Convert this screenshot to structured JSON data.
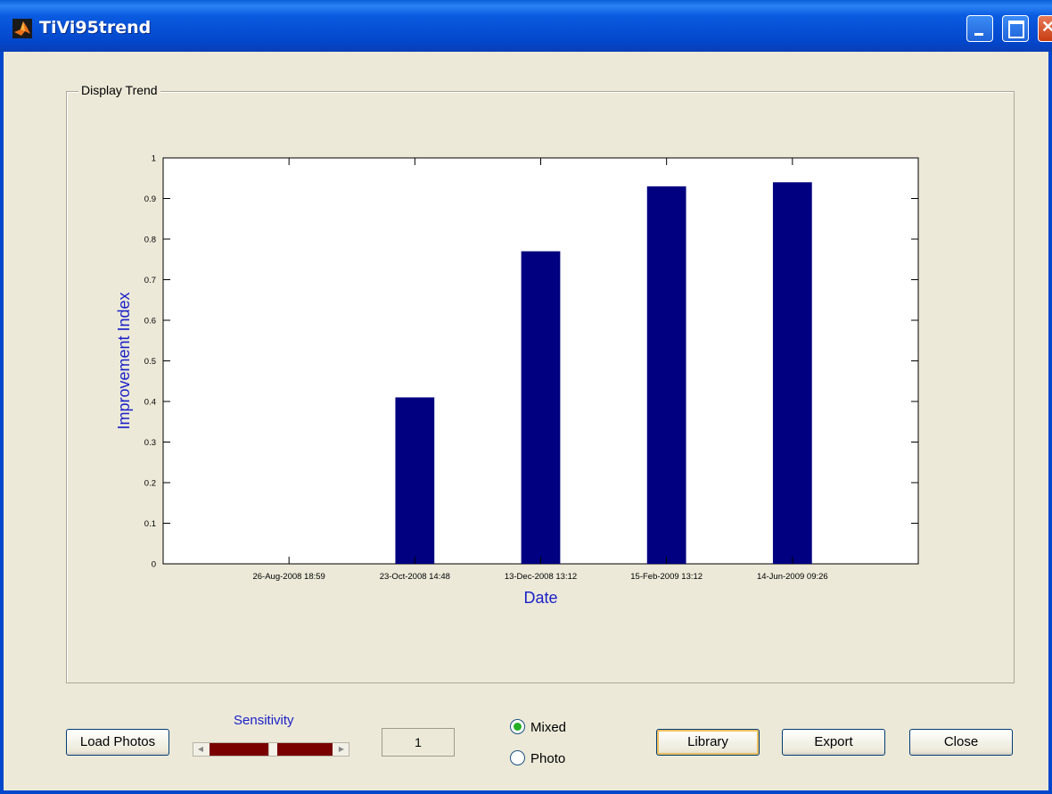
{
  "window": {
    "title": "TiVi95trend"
  },
  "panel": {
    "title": "Display Trend"
  },
  "chart_data": {
    "type": "bar",
    "categories": [
      "26-Aug-2008 18:59",
      "23-Oct-2008 14:48",
      "13-Dec-2008 13:12",
      "15-Feb-2009 13:12",
      "14-Jun-2009 09:26"
    ],
    "values": [
      0,
      0.41,
      0.77,
      0.93,
      0.94
    ],
    "title": "",
    "xlabel": "Date",
    "ylabel": "Improvement Index",
    "ylim": [
      0,
      1
    ],
    "yticks": [
      "0",
      "0.1",
      "0.2",
      "0.3",
      "0.4",
      "0.5",
      "0.6",
      "0.7",
      "0.8",
      "0.9",
      "1"
    ],
    "bar_color": "#000080",
    "label_color": "#1b20c8"
  },
  "controls": {
    "load_photos_label": "Load Photos",
    "sensitivity_label": "Sensitivity",
    "sensitivity_value": "1",
    "mode_options": [
      {
        "label": "Mixed",
        "checked": true
      },
      {
        "label": "Photo",
        "checked": false
      }
    ],
    "library_label": "Library",
    "export_label": "Export",
    "close_label": "Close"
  }
}
